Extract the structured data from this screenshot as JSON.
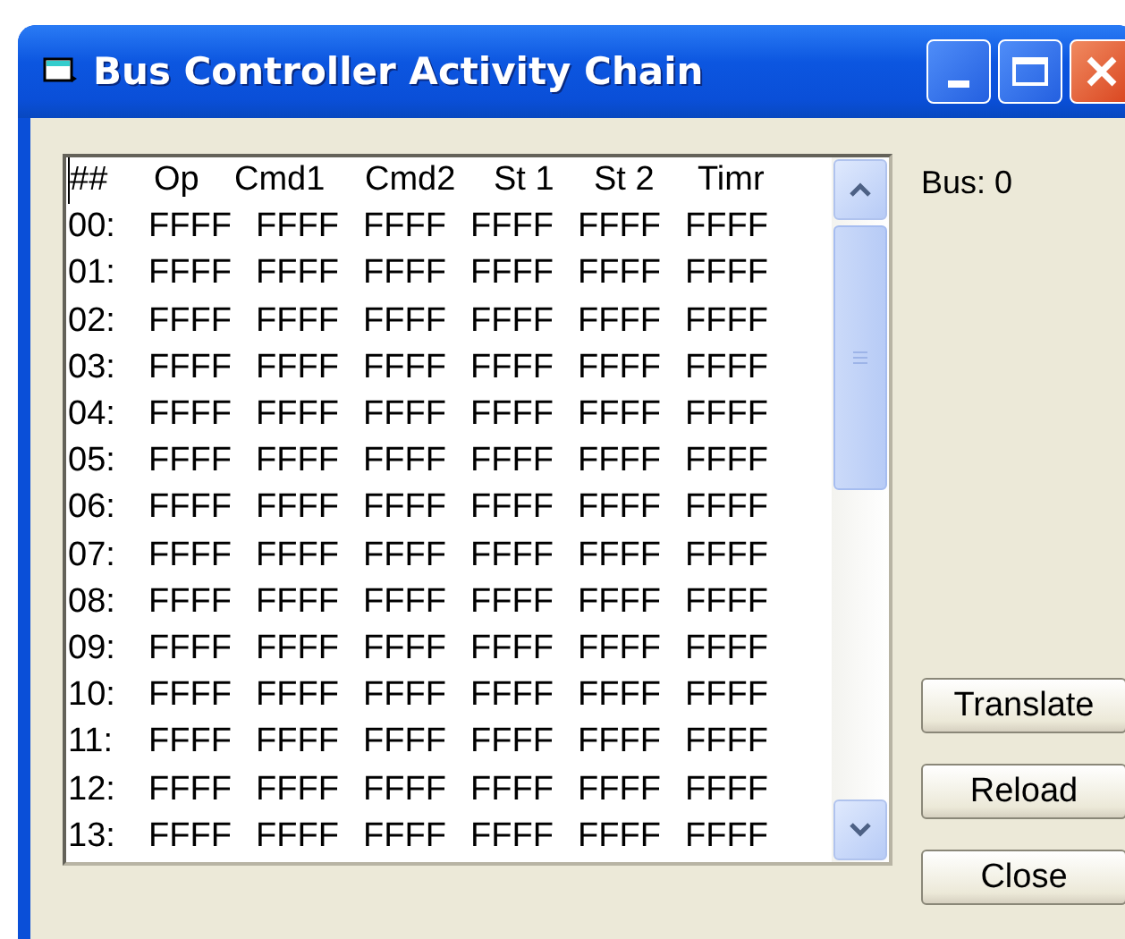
{
  "window": {
    "title": "Bus Controller Activity Chain"
  },
  "listing": {
    "columns": [
      "##",
      "Op",
      "Cmd1",
      "Cmd2",
      "St 1",
      "St 2",
      "Timr"
    ],
    "rows": [
      [
        "00:",
        "FFFF",
        "FFFF",
        "FFFF",
        "FFFF",
        "FFFF",
        "FFFF"
      ],
      [
        "01:",
        "FFFF",
        "FFFF",
        "FFFF",
        "FFFF",
        "FFFF",
        "FFFF"
      ],
      [
        "02:",
        "FFFF",
        "FFFF",
        "FFFF",
        "FFFF",
        "FFFF",
        "FFFF"
      ],
      [
        "03:",
        "FFFF",
        "FFFF",
        "FFFF",
        "FFFF",
        "FFFF",
        "FFFF"
      ],
      [
        "04:",
        "FFFF",
        "FFFF",
        "FFFF",
        "FFFF",
        "FFFF",
        "FFFF"
      ],
      [
        "05:",
        "FFFF",
        "FFFF",
        "FFFF",
        "FFFF",
        "FFFF",
        "FFFF"
      ],
      [
        "06:",
        "FFFF",
        "FFFF",
        "FFFF",
        "FFFF",
        "FFFF",
        "FFFF"
      ],
      [
        "07:",
        "FFFF",
        "FFFF",
        "FFFF",
        "FFFF",
        "FFFF",
        "FFFF"
      ],
      [
        "08:",
        "FFFF",
        "FFFF",
        "FFFF",
        "FFFF",
        "FFFF",
        "FFFF"
      ],
      [
        "09:",
        "FFFF",
        "FFFF",
        "FFFF",
        "FFFF",
        "FFFF",
        "FFFF"
      ],
      [
        "10:",
        "FFFF",
        "FFFF",
        "FFFF",
        "FFFF",
        "FFFF",
        "FFFF"
      ],
      [
        "11:",
        "FFFF",
        "FFFF",
        "FFFF",
        "FFFF",
        "FFFF",
        "FFFF"
      ],
      [
        "12:",
        "FFFF",
        "FFFF",
        "FFFF",
        "FFFF",
        "FFFF",
        "FFFF"
      ],
      [
        "13:",
        "FFFF",
        "FFFF",
        "FFFF",
        "FFFF",
        "FFFF",
        "FFFF"
      ]
    ]
  },
  "bus_label": "Bus: 0",
  "buttons": [
    "Translate",
    "Reload",
    "Close"
  ]
}
